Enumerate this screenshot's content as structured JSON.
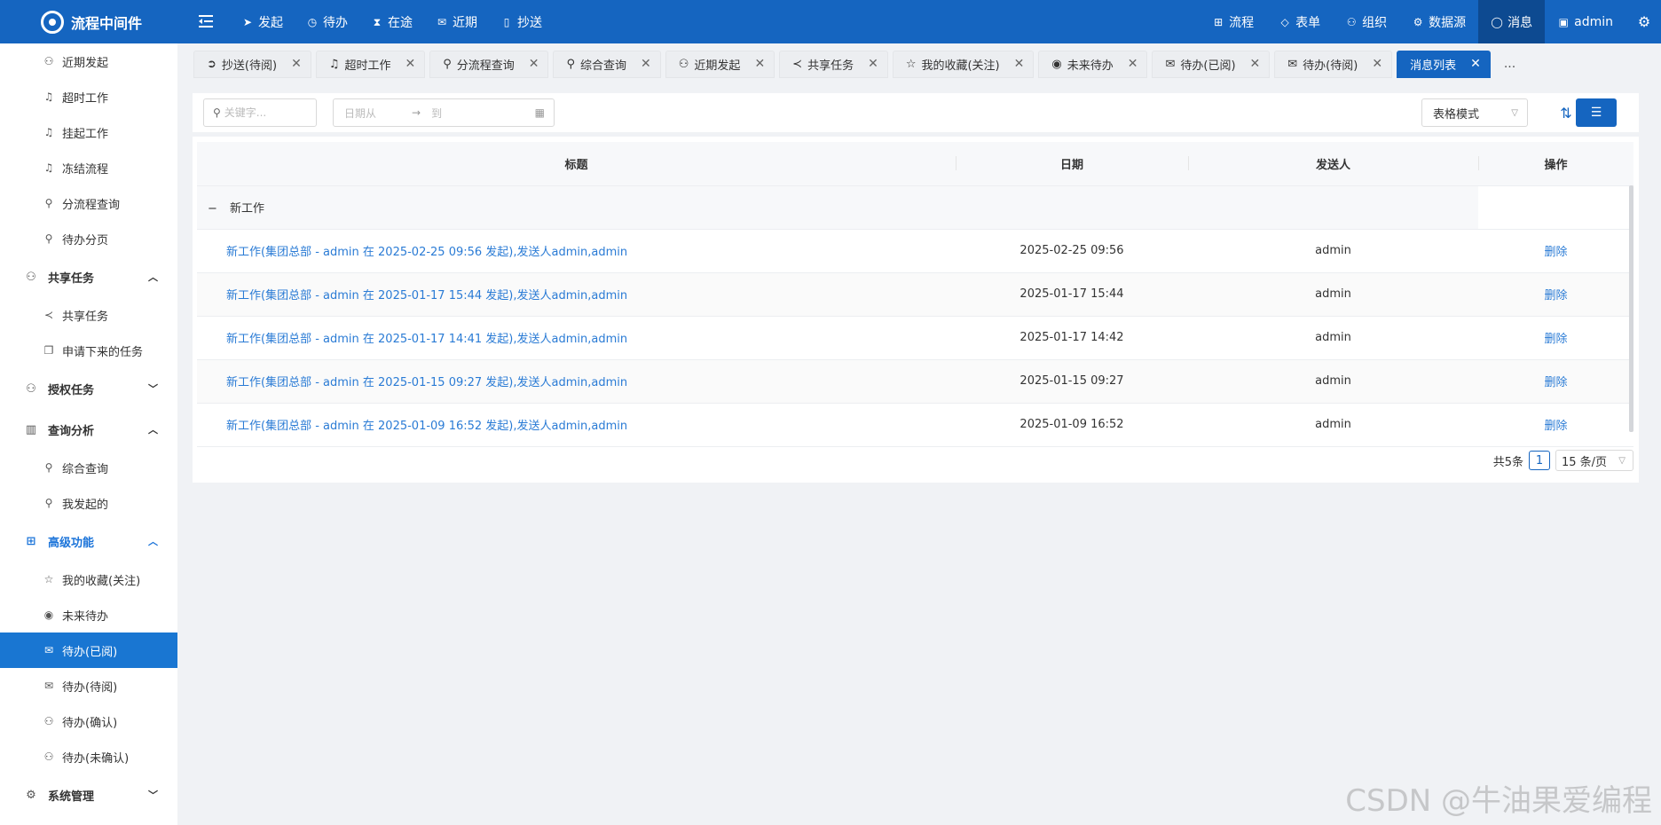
{
  "app": {
    "title": "流程中间件"
  },
  "nav_left": [
    {
      "label": "发起",
      "icon": "send-icon"
    },
    {
      "label": "待办",
      "icon": "clock-icon"
    },
    {
      "label": "在途",
      "icon": "hourglass-icon"
    },
    {
      "label": "近期",
      "icon": "mail-icon"
    },
    {
      "label": "抄送",
      "icon": "clipboard-icon"
    }
  ],
  "nav_right": [
    {
      "label": "流程",
      "icon": "flow-icon"
    },
    {
      "label": "表单",
      "icon": "diamond-icon"
    },
    {
      "label": "组织",
      "icon": "org-icon"
    },
    {
      "label": "数据源",
      "icon": "gear-icon"
    },
    {
      "label": "消息",
      "icon": "chat-icon",
      "active": true
    },
    {
      "label": "admin",
      "icon": "user-avatar-icon"
    }
  ],
  "sidebar": {
    "items_a": [
      {
        "label": "近期发起",
        "icon": "user-icon"
      },
      {
        "label": "超时工作",
        "icon": "bell-icon"
      },
      {
        "label": "挂起工作",
        "icon": "bell-icon"
      },
      {
        "label": "冻结流程",
        "icon": "bell-icon"
      },
      {
        "label": "分流程查询",
        "icon": "search-icon"
      },
      {
        "label": "待办分页",
        "icon": "search-icon"
      }
    ],
    "group_share": "共享任务",
    "items_share": [
      {
        "label": "共享任务",
        "icon": "share-icon"
      },
      {
        "label": "申请下来的任务",
        "icon": "copy-icon"
      }
    ],
    "group_auth": "授权任务",
    "group_query": "查询分析",
    "items_query": [
      {
        "label": "综合查询",
        "icon": "search-icon"
      },
      {
        "label": "我发起的",
        "icon": "search-icon"
      }
    ],
    "group_adv": "高级功能",
    "items_adv": [
      {
        "label": "我的收藏(关注)",
        "icon": "star-icon"
      },
      {
        "label": "未来待办",
        "icon": "eye-icon"
      },
      {
        "label": "待办(已阅)",
        "icon": "mail-open-icon",
        "active": true
      },
      {
        "label": "待办(待阅)",
        "icon": "mail-icon"
      },
      {
        "label": "待办(确认)",
        "icon": "user-icon"
      },
      {
        "label": "待办(未确认)",
        "icon": "user-icon"
      }
    ],
    "group_sys": "系统管理"
  },
  "tabs": [
    {
      "label": "抄送(待阅)",
      "icon": "arrow-circle-icon"
    },
    {
      "label": "超时工作",
      "icon": "bell-icon"
    },
    {
      "label": "分流程查询",
      "icon": "search-icon"
    },
    {
      "label": "综合查询",
      "icon": "search-icon"
    },
    {
      "label": "近期发起",
      "icon": "user-icon"
    },
    {
      "label": "共享任务",
      "icon": "share-icon"
    },
    {
      "label": "我的收藏(关注)",
      "icon": "star-icon"
    },
    {
      "label": "未来待办",
      "icon": "eye-icon"
    },
    {
      "label": "待办(已阅)",
      "icon": "mail-open-icon"
    },
    {
      "label": "待办(待阅)",
      "icon": "mail-icon"
    },
    {
      "label": "消息列表",
      "icon": "",
      "active": true
    }
  ],
  "tabs_more": "...",
  "filter": {
    "keyword_placeholder": "关键字...",
    "date_from_placeholder": "日期从",
    "date_to_placeholder": "到",
    "mode": "表格模式"
  },
  "table": {
    "headers": [
      "标题",
      "日期",
      "发送人",
      "操作"
    ],
    "group_toggle": "−",
    "group_label": "新工作",
    "rows": [
      {
        "title": "新工作(集团总部 - admin 在 2025-02-25 09:56 发起),发送人admin,admin",
        "date": "2025-02-25 09:56",
        "sender": "admin",
        "op": "删除"
      },
      {
        "title": "新工作(集团总部 - admin 在 2025-01-17 15:44 发起),发送人admin,admin",
        "date": "2025-01-17 15:44",
        "sender": "admin",
        "op": "删除"
      },
      {
        "title": "新工作(集团总部 - admin 在 2025-01-17 14:41 发起),发送人admin,admin",
        "date": "2025-01-17 14:42",
        "sender": "admin",
        "op": "删除"
      },
      {
        "title": "新工作(集团总部 - admin 在 2025-01-15 09:27 发起),发送人admin,admin",
        "date": "2025-01-15 09:27",
        "sender": "admin",
        "op": "删除"
      },
      {
        "title": "新工作(集团总部 - admin 在 2025-01-09 16:52 发起),发送人admin,admin",
        "date": "2025-01-09 16:52",
        "sender": "admin",
        "op": "删除"
      }
    ]
  },
  "pager": {
    "total": "共5条",
    "page": "1",
    "page_size": "15 条/页"
  },
  "watermark": "CSDN @牛油果爱编程",
  "colors": {
    "primary": "#1565c0",
    "link": "#2a7bd5",
    "sidebar_active": "#1976d2"
  }
}
